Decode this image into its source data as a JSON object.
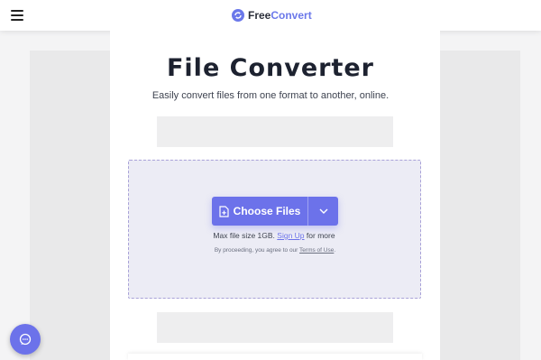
{
  "header": {
    "menu_icon": "hamburger-menu-icon",
    "brand": {
      "logo_icon": "freeconvert-logo-icon",
      "name_part1": "Free",
      "name_part2": "Convert",
      "accent_color": "#6b78ea"
    }
  },
  "hero": {
    "title": "File Converter",
    "subtitle": "Easily convert files from one format to another, online."
  },
  "upload": {
    "choose_label": "Choose Files",
    "choose_icon": "file-add-icon",
    "dropdown_icon": "chevron-down-icon",
    "button_color": "#6c72ea",
    "limit_prefix": "Max file size 1GB.",
    "signup_link": "Sign Up",
    "limit_suffix": "for more",
    "terms_prefix": "By proceeding, you agree to our",
    "terms_link": "Terms of Use",
    "terms_suffix": "."
  },
  "chat": {
    "icon": "chat-bubble-icon"
  }
}
